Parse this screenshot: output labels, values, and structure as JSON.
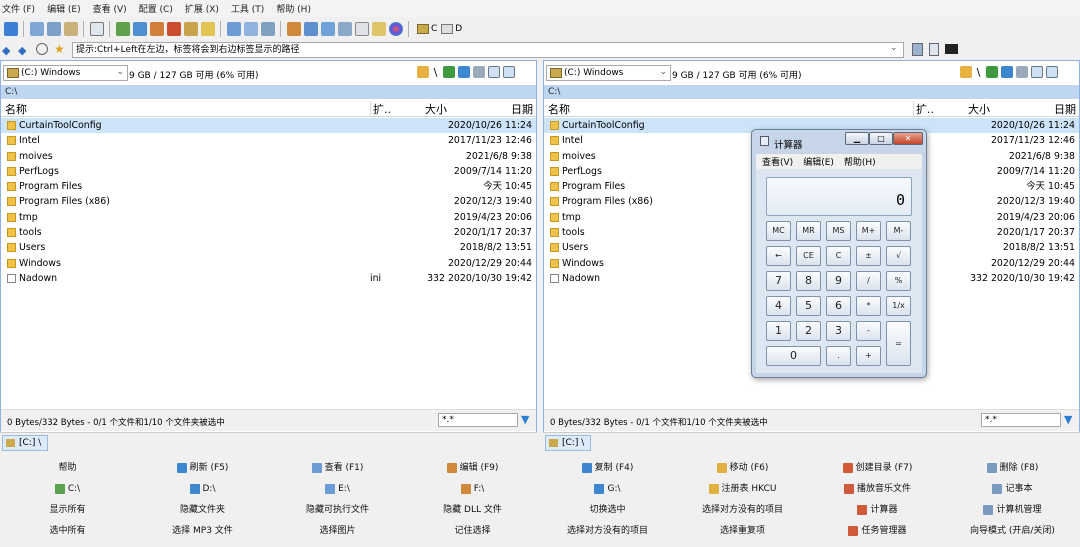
{
  "menu": [
    "文件 (F)",
    "编辑 (E)",
    "查看 (V)",
    "配置 (C)",
    "扩展 (X)",
    "工具 (T)",
    "帮助 (H)"
  ],
  "toolbar": {
    "drive_c": "C",
    "drive_d": "D"
  },
  "address": {
    "hint": "提示:Ctrl+Left在左边，标签将会到右边标签显示的路径"
  },
  "panels": [
    {
      "id": "left",
      "drive": "(C:) Windows",
      "free": "9 GB / 127 GB 可用 (6% 可用)",
      "path": "C:\\",
      "headers": {
        "name": "名称",
        "ext": "扩..",
        "size": "大小",
        "date": "日期"
      },
      "rows": [
        {
          "name": "CurtainToolConfig",
          "ext": "",
          "info": "2020/10/26 11:24",
          "type": "folder"
        },
        {
          "name": "Intel",
          "ext": "",
          "info": "2017/11/23 12:46",
          "type": "folder"
        },
        {
          "name": "moives",
          "ext": "",
          "info": "2021/6/8 9:38",
          "type": "folder"
        },
        {
          "name": "PerfLogs",
          "ext": "",
          "info": "2009/7/14 11:20",
          "type": "folder"
        },
        {
          "name": "Program Files",
          "ext": "",
          "info": "今天 10:45",
          "type": "folder"
        },
        {
          "name": "Program Files (x86)",
          "ext": "",
          "info": "2020/12/3 19:40",
          "type": "folder"
        },
        {
          "name": "tmp",
          "ext": "",
          "info": "2019/4/23 20:06",
          "type": "folder"
        },
        {
          "name": "tools",
          "ext": "",
          "info": "2020/1/17 20:37",
          "type": "folder"
        },
        {
          "name": "Users",
          "ext": "",
          "info": "2018/8/2 13:51",
          "type": "folder"
        },
        {
          "name": "Windows",
          "ext": "",
          "info": "2020/12/29 20:44",
          "type": "folder"
        },
        {
          "name": "Nadown",
          "ext": "ini",
          "info": "332 2020/10/30 19:42",
          "type": "file"
        }
      ],
      "status": "0 Bytes/332 Bytes - 0/1 个文件和1/10 个文件夹被选中",
      "filter": "*.*",
      "tab": "[C:] \\"
    },
    {
      "id": "right",
      "drive": "(C:) Windows",
      "free": "9 GB / 127 GB 可用 (6% 可用)",
      "path": "C:\\",
      "headers": {
        "name": "名称",
        "ext": "扩..",
        "size": "大小",
        "date": "日期"
      },
      "rows": [
        {
          "name": "CurtainToolConfig",
          "ext": "",
          "info": "2020/10/26 11:24",
          "type": "folder"
        },
        {
          "name": "Intel",
          "ext": "",
          "info": "2017/11/23 12:46",
          "type": "folder"
        },
        {
          "name": "moives",
          "ext": "",
          "info": "2021/6/8 9:38",
          "type": "folder"
        },
        {
          "name": "PerfLogs",
          "ext": "",
          "info": "2009/7/14 11:20",
          "type": "folder"
        },
        {
          "name": "Program Files",
          "ext": "",
          "info": "今天 10:45",
          "type": "folder"
        },
        {
          "name": "Program Files (x86)",
          "ext": "",
          "info": "2020/12/3 19:40",
          "type": "folder"
        },
        {
          "name": "tmp",
          "ext": "",
          "info": "2019/4/23 20:06",
          "type": "folder"
        },
        {
          "name": "tools",
          "ext": "",
          "info": "2020/1/17 20:37",
          "type": "folder"
        },
        {
          "name": "Users",
          "ext": "",
          "info": "2018/8/2 13:51",
          "type": "folder"
        },
        {
          "name": "Windows",
          "ext": "",
          "info": "2020/12/29 20:44",
          "type": "folder"
        },
        {
          "name": "Nadown",
          "ext": "",
          "info": "332 2020/10/30 19:42",
          "type": "file"
        }
      ],
      "status": "0 Bytes/332 Bytes - 0/1 个文件和1/10 个文件夹被选中",
      "filter": "*.*",
      "tab": "[C:] \\"
    }
  ],
  "buttons": [
    [
      "帮助",
      "刷新 (F5)",
      "查看 (F1)",
      "编辑 (F9)",
      "复制 (F4)",
      "移动 (F6)",
      "创建目录 (F7)",
      "删除 (F8)"
    ],
    [
      "C:\\",
      "D:\\",
      "E:\\",
      "F:\\",
      "G:\\",
      "注册表 HKCU",
      "播放音乐文件",
      "记事本"
    ],
    [
      "显示所有",
      "隐藏文件夹",
      "隐藏可执行文件",
      "隐藏 DLL 文件",
      "切换选中",
      "选择对方没有的项目",
      "计算器",
      "计算机管理"
    ],
    [
      "选中所有",
      "选择 MP3 文件",
      "选择图片",
      "记住选择",
      "选择对方没有的项目",
      "选择重复项",
      "任务管理器",
      "向导模式 (开启/关闭)"
    ]
  ],
  "calculator": {
    "title": "计算器",
    "menu": [
      "查看(V)",
      "编辑(E)",
      "帮助(H)"
    ],
    "display": "0",
    "keys": [
      [
        "MC",
        "MR",
        "MS",
        "M+",
        "M-"
      ],
      [
        "←",
        "CE",
        "C",
        "±",
        "√"
      ],
      [
        "7",
        "8",
        "9",
        "/",
        "%"
      ],
      [
        "4",
        "5",
        "6",
        "*",
        "1/x"
      ],
      [
        "1",
        "2",
        "3",
        "-",
        "="
      ],
      [
        "0",
        ".",
        "+"
      ]
    ]
  },
  "colors": {
    "selection": "#cce3f8",
    "path_bar": "#bfd6f0",
    "panel_border": "#8db2e3",
    "folder": "#f0c24b"
  }
}
